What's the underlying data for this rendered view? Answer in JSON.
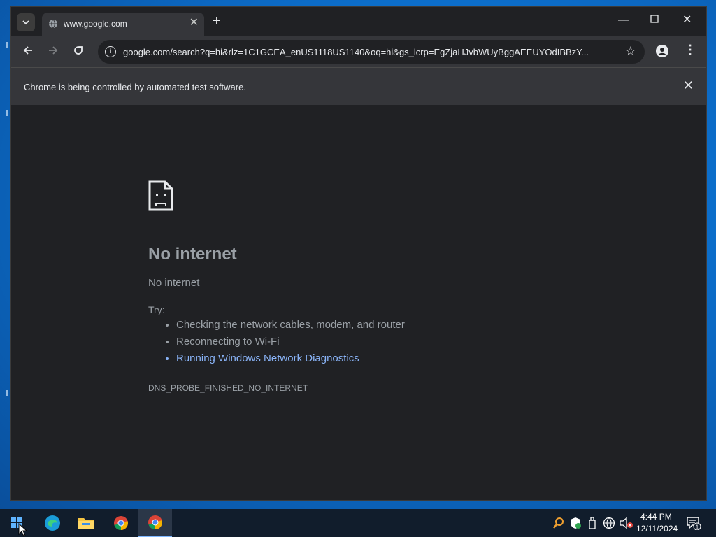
{
  "browser": {
    "tab": {
      "title": "www.google.com"
    },
    "address_bar": {
      "url": "google.com/search?q=hi&rlz=1C1GCEA_enUS1118US1140&oq=hi&gs_lcrp=EgZjaHJvbWUyBggAEEUYOdIBBzY..."
    },
    "infobar": {
      "message": "Chrome is being controlled by automated test software."
    }
  },
  "error_page": {
    "heading": "No internet",
    "subheading": "No internet",
    "try_label": "Try:",
    "suggestions": [
      "Checking the network cables, modem, and router",
      "Reconnecting to Wi-Fi",
      "Running Windows Network Diagnostics"
    ],
    "error_code": "DNS_PROBE_FINISHED_NO_INTERNET"
  },
  "taskbar": {
    "apps": [
      "edge-icon",
      "file-explorer-icon",
      "chrome-icon",
      "chrome-icon"
    ],
    "clock": {
      "time": "4:44 PM",
      "date": "12/11/2024"
    },
    "notification_count": "1"
  },
  "colors": {
    "link": "#8ab4f8",
    "page_bg": "#202124",
    "toolbar_bg": "#35363a"
  }
}
